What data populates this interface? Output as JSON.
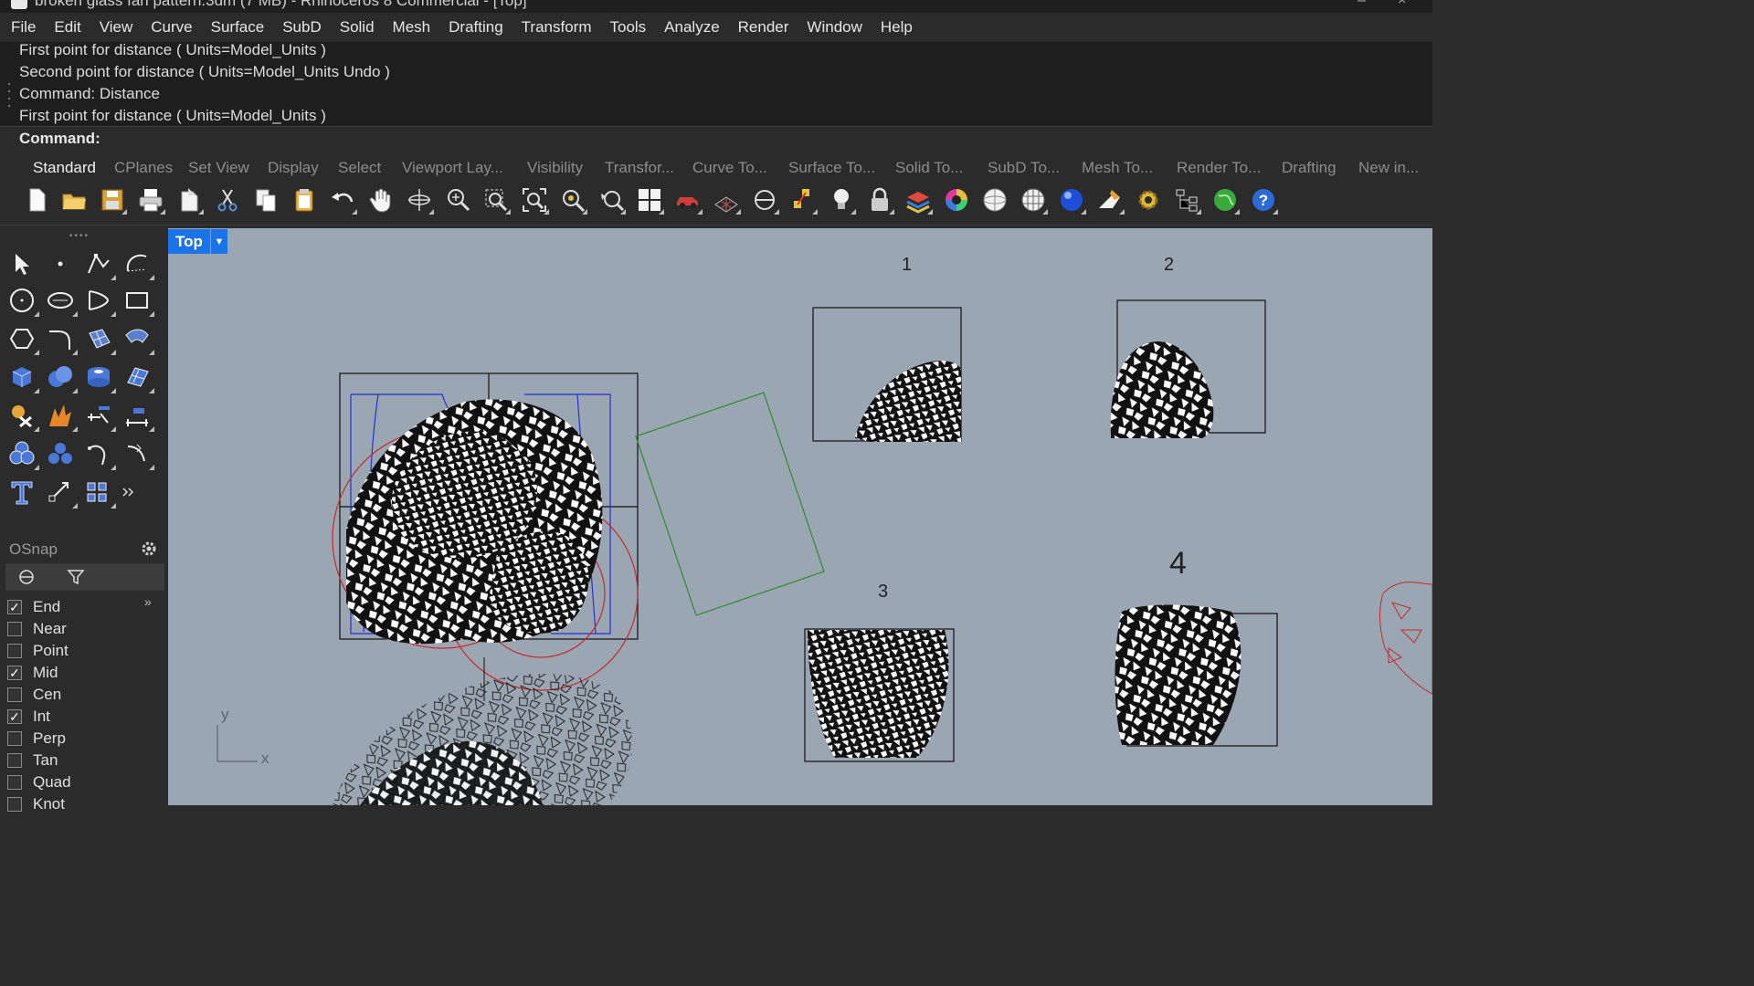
{
  "window": {
    "title": "broken glass fan pattern.3dm (7 MB) - Rhinoceros 8 Commercial - [Top]"
  },
  "menu": [
    "File",
    "Edit",
    "View",
    "Curve",
    "Surface",
    "SubD",
    "Solid",
    "Mesh",
    "Drafting",
    "Transform",
    "Tools",
    "Analyze",
    "Render",
    "Window",
    "Help"
  ],
  "history": [
    "First point for distance ( Units=Model_Units )",
    "Second point for distance ( Units=Model_Units  Undo )",
    "Command: Distance",
    "First point for distance ( Units=Model_Units )"
  ],
  "command": {
    "label": "Command:",
    "value": ""
  },
  "tabs": [
    "Standard",
    "CPlanes",
    "Set View",
    "Display",
    "Select",
    "Viewport Lay...",
    "Visibility",
    "Transfor...",
    "Curve To...",
    "Surface To...",
    "Solid To...",
    "SubD To...",
    "Mesh To...",
    "Render To...",
    "Drafting",
    "New in..."
  ],
  "active_tab": "Standard",
  "toolbar_icons": [
    "new-file-icon",
    "open-folder-icon",
    "save-icon",
    "print-icon",
    "import-icon",
    "cut-icon",
    "copy-icon",
    "paste-icon",
    "undo-icon",
    "pan-hand-icon",
    "rotate-view-icon",
    "zoom-icon",
    "zoom-window-icon",
    "zoom-extents-icon",
    "zoom-selected-icon",
    "undo-view-icon",
    "four-viewports-icon",
    "car-icon",
    "grid-icon",
    "osnap-icon",
    "points-icon",
    "light-icon",
    "lock-icon",
    "layers-icon",
    "color-wheel-icon",
    "sphere-icon",
    "mesh-sphere-icon",
    "render-sphere-icon",
    "materials-icon",
    "settings-gear-icon",
    "hierarchy-icon",
    "globe-icon",
    "help-icon"
  ],
  "osnap": {
    "title": "OSnap",
    "items": [
      {
        "label": "End",
        "checked": true
      },
      {
        "label": "Near",
        "checked": false
      },
      {
        "label": "Point",
        "checked": false
      },
      {
        "label": "Mid",
        "checked": true
      },
      {
        "label": "Cen",
        "checked": false
      },
      {
        "label": "Int",
        "checked": true
      },
      {
        "label": "Perp",
        "checked": false
      },
      {
        "label": "Tan",
        "checked": false
      },
      {
        "label": "Quad",
        "checked": false
      },
      {
        "label": "Knot",
        "checked": false
      }
    ]
  },
  "viewport": {
    "name": "Top",
    "labels": [
      "1",
      "2",
      "3",
      "4"
    ],
    "axis_x": "x",
    "axis_y": "y",
    "colors": {
      "background": "#9ba6b3",
      "blue_outline": "#2b2bd6",
      "red_circle": "#c42a2a",
      "green_rect": "#2e8b2e",
      "tab": "#1a73e8"
    }
  }
}
